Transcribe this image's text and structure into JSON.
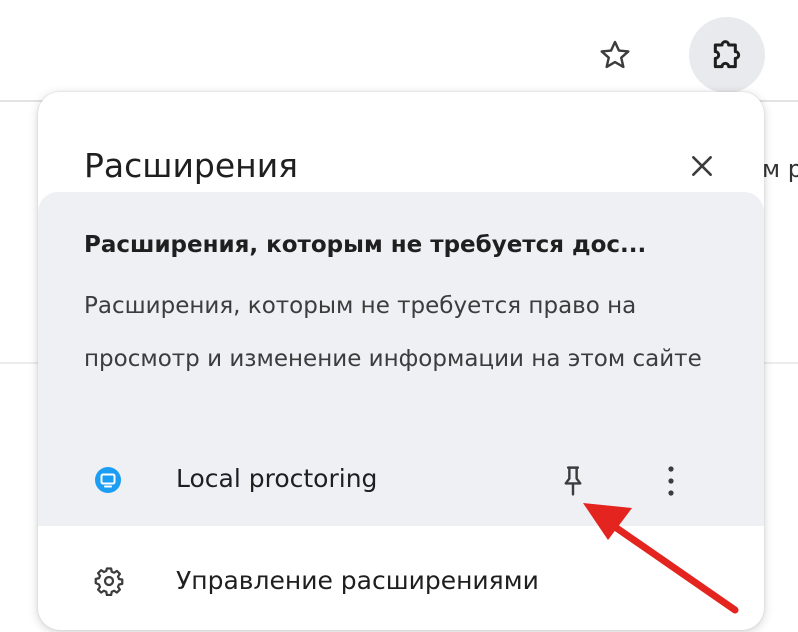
{
  "background": {
    "partial_text": "м р"
  },
  "popup": {
    "title": "Расширения",
    "section": {
      "heading": "Расширения, которым не требуется дос...",
      "description": "Расширения, которым не требуется право на просмотр и изменение информации на этом сайте"
    },
    "extensions": [
      {
        "name": "Local proctoring",
        "icon": "monitor-icon",
        "icon_color": "#1a9df2"
      }
    ],
    "manage_label": "Управление расширениями"
  },
  "colors": {
    "annotation_arrow": "#e3241f",
    "section_bg": "#eef0f4"
  }
}
